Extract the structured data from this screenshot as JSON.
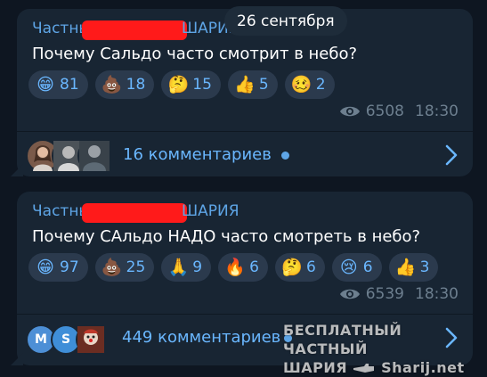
{
  "date_pill": "26 сентября",
  "posts": [
    {
      "channel_prefix": "Частны",
      "channel_suffix": "ШАРИЯ",
      "text": "Почему Сальдо часто смотрит в небо?",
      "reactions": [
        {
          "emoji": "😁",
          "icon": "grinning-face-icon",
          "count": "81"
        },
        {
          "emoji": "💩",
          "icon": "pile-of-poo-icon",
          "count": "18"
        },
        {
          "emoji": "🤔",
          "icon": "thinking-face-icon",
          "count": "15"
        },
        {
          "emoji": "👍",
          "icon": "thumbs-up-icon",
          "count": "5"
        },
        {
          "emoji": "🥴",
          "icon": "woozy-face-icon",
          "count": "2"
        }
      ],
      "views": "6508",
      "time": "18:30",
      "comments_label": "16 комментариев"
    },
    {
      "channel_prefix": "Частны",
      "channel_suffix": "ШАРИЯ",
      "text": "Почему САльдо НАДО часто смотреть в небо?",
      "reactions": [
        {
          "emoji": "😁",
          "icon": "grinning-face-icon",
          "count": "97"
        },
        {
          "emoji": "💩",
          "icon": "pile-of-poo-icon",
          "count": "25"
        },
        {
          "emoji": "🙏",
          "icon": "folded-hands-icon",
          "count": "9"
        },
        {
          "emoji": "🔥",
          "icon": "fire-icon",
          "count": "6"
        },
        {
          "emoji": "🤔",
          "icon": "thinking-face-icon",
          "count": "6"
        },
        {
          "emoji": "😢",
          "icon": "crying-face-icon",
          "count": "6"
        },
        {
          "emoji": "👍",
          "icon": "thumbs-up-icon",
          "count": "3"
        }
      ],
      "views": "6539",
      "time": "18:30",
      "comments_label": "449 комментариев",
      "avatar_letters": [
        "M",
        "S"
      ]
    }
  ],
  "watermark": {
    "line1": "БЕСПЛАТНЫЙ ЧАСТНЫЙ",
    "line2_left": "ШАРИЯ",
    "line2_right": "Sharij.net"
  },
  "colors": {
    "background": "#0e1621",
    "bubble": "#182533",
    "accent": "#6ab7ff",
    "redaction": "#ff1a1a"
  }
}
